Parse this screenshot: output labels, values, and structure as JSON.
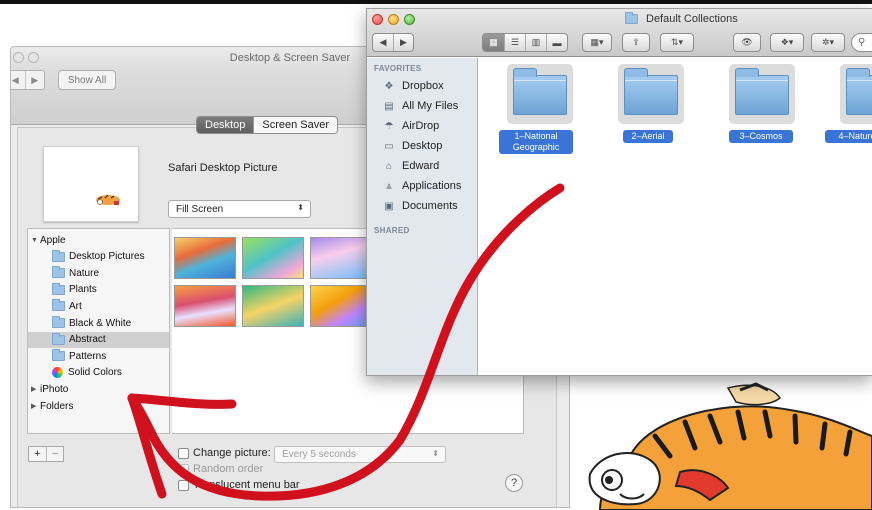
{
  "prefs": {
    "title": "Desktop & Screen Saver",
    "show_all": "Show All",
    "tabs": [
      "Desktop",
      "Screen Saver"
    ],
    "picture_name": "Safari Desktop Picture",
    "fill_mode": "Fill Screen",
    "source_list": [
      {
        "label": "Apple",
        "kind": "group",
        "expanded": true
      },
      {
        "label": "Desktop Pictures",
        "kind": "folder"
      },
      {
        "label": "Nature",
        "kind": "folder"
      },
      {
        "label": "Plants",
        "kind": "folder"
      },
      {
        "label": "Art",
        "kind": "folder"
      },
      {
        "label": "Black & White",
        "kind": "folder"
      },
      {
        "label": "Abstract",
        "kind": "folder",
        "selected": true
      },
      {
        "label": "Patterns",
        "kind": "folder"
      },
      {
        "label": "Solid Colors",
        "kind": "color"
      },
      {
        "label": "iPhoto",
        "kind": "group",
        "expanded": false
      },
      {
        "label": "Folders",
        "kind": "group",
        "expanded": false
      }
    ],
    "add_label": "+",
    "remove_label": "−",
    "change_picture_label": "Change picture:",
    "interval_value": "Every 5 seconds",
    "random_order_label": "Random order",
    "translucent_label": "Translucent menu bar",
    "help_label": "?"
  },
  "finder": {
    "title": "Default Collections",
    "sidebar_heading_favorites": "FAVORITES",
    "sidebar_heading_shared": "SHARED",
    "favorites": [
      {
        "label": "Dropbox",
        "icon": "dropbox-icon"
      },
      {
        "label": "All My Files",
        "icon": "all-files-icon"
      },
      {
        "label": "AirDrop",
        "icon": "airdrop-icon"
      },
      {
        "label": "Desktop",
        "icon": "desktop-icon"
      },
      {
        "label": "Edward",
        "icon": "home-icon"
      },
      {
        "label": "Applications",
        "icon": "applications-icon"
      },
      {
        "label": "Documents",
        "icon": "documents-icon"
      }
    ],
    "items": [
      {
        "label": "1–National Geographic"
      },
      {
        "label": "2–Aerial"
      },
      {
        "label": "3–Cosmos"
      },
      {
        "label": "4–Nature"
      }
    ]
  },
  "colors": {
    "selection_blue": "#3b74d7",
    "arrow_red": "#d0101c",
    "folder_blue": "#6ea4d6"
  }
}
